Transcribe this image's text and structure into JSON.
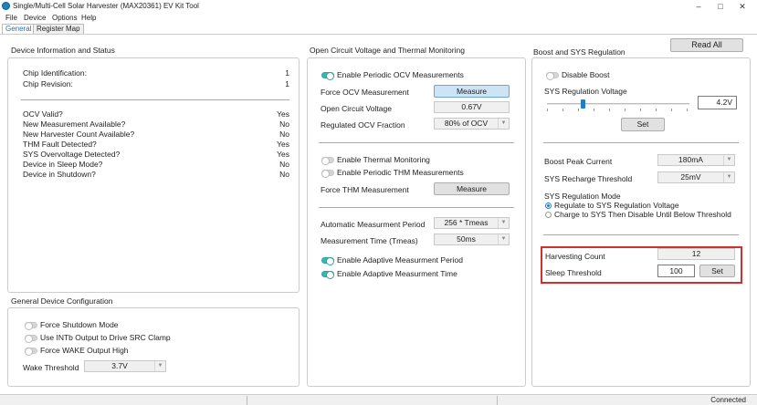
{
  "window": {
    "title": "Single/Multi-Cell Solar Harvester (MAX20361) EV Kit Tool",
    "minimize": "–",
    "maximize": "□",
    "close": "✕"
  },
  "menu": [
    "File",
    "Device",
    "Options",
    "Help"
  ],
  "tabs": [
    "General",
    "Register Map"
  ],
  "read_all": "Read All",
  "device_info": {
    "title": "Device Information and Status",
    "chip_id_label": "Chip Identification:",
    "chip_id": "1",
    "chip_rev_label": "Chip Revision:",
    "chip_rev": "1",
    "rows": [
      {
        "label": "OCV Valid?",
        "value": "Yes"
      },
      {
        "label": "New  Measurement Available?",
        "value": "No"
      },
      {
        "label": "New Harvester Count Available?",
        "value": "No"
      },
      {
        "label": "THM Fault Detected?",
        "value": "Yes"
      },
      {
        "label": "SYS Overvoltage Detected?",
        "value": "Yes"
      },
      {
        "label": "Device in Sleep Mode?",
        "value": "No"
      },
      {
        "label": "Device in Shutdown?",
        "value": "No"
      }
    ]
  },
  "general_config": {
    "title": "General Device Configuration",
    "force_shutdown": "Force Shutdown Mode",
    "intb": "Use INTb Output to Drive SRC Clamp",
    "force_wake": "Force WAKE Output High",
    "wake_threshold_label": "Wake Threshold",
    "wake_threshold": "3.7V"
  },
  "ocv": {
    "title": "Open Circuit Voltage and Thermal Monitoring",
    "enable_periodic_ocv": "Enable Periodic OCV Measurements",
    "force_ocv_label": "Force OCV Measurement",
    "measure_btn": "Measure",
    "ocv_label": "Open Circuit Voltage",
    "ocv_value": "0.67V",
    "reg_ocv_label": "Regulated OCV Fraction",
    "reg_ocv_value": "80% of OCV",
    "enable_thermal": "Enable Thermal Monitoring",
    "enable_periodic_thm": "Enable Periodic THM Measurements",
    "force_thm_label": "Force THM Measurement",
    "measure_thm_btn": "Measure",
    "auto_period_label": "Automatic Measurment Period",
    "auto_period_value": "256 * Tmeas",
    "meas_time_label": "Measurement Time (Tmeas)",
    "meas_time_value": "50ms",
    "adaptive_period": "Enable Adaptive Measurment Period",
    "adaptive_time": "Enable Adaptive Measurment Time"
  },
  "boost": {
    "title": "Boost and SYS Regulation",
    "disable_boost": "Disable Boost",
    "sys_reg_label": "SYS Regulation Voltage",
    "sys_reg_value": "4.2V",
    "set_btn": "Set",
    "peak_current_label": "Boost Peak Current",
    "peak_current_value": "180mA",
    "recharge_label": "SYS Recharge Threshold",
    "recharge_value": "25mV",
    "mode_label": "SYS Regulation Mode",
    "mode_opt1": "Regulate to SYS Regulation Voltage",
    "mode_opt2": "Charge to SYS Then Disable Until Below Threshold",
    "harvest_label": "Harvesting Count",
    "harvest_value": "12",
    "sleep_label": "Sleep Threshold",
    "sleep_value": "100",
    "sleep_set_btn": "Set"
  },
  "status": {
    "connection": "Connected"
  },
  "colors": {
    "accent": "#1a73c8",
    "toggle_on": "#3ab6b6",
    "highlight": "#d32f2f"
  },
  "icons": {
    "app": "app-logo-icon"
  }
}
